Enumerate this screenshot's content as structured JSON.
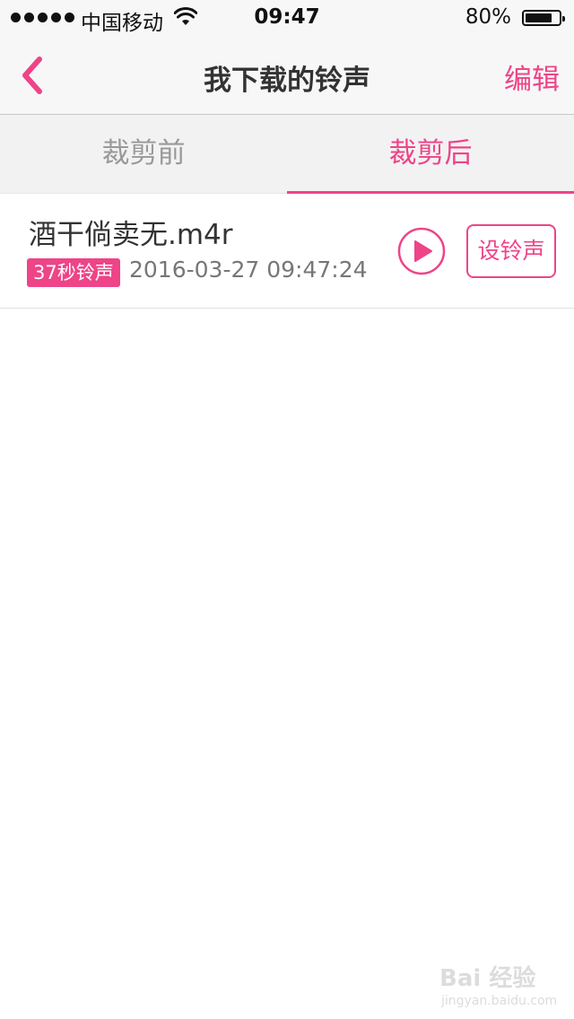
{
  "status_bar": {
    "carrier": "中国移动",
    "time": "09:47",
    "battery_percent": "80%",
    "battery_level": 0.8,
    "signal_bars": 5
  },
  "nav": {
    "title": "我下载的铃声",
    "edit_label": "编辑",
    "back_icon": "chevron-left-icon"
  },
  "tabs": [
    {
      "label": "裁剪前",
      "active": false
    },
    {
      "label": "裁剪后",
      "active": true
    }
  ],
  "ringtones": [
    {
      "name": "酒干倘卖无.m4r",
      "duration_badge": "37秒铃声",
      "date": "2016-03-27 09:47:24",
      "set_label": "设铃声"
    }
  ],
  "watermark": {
    "logo_text": "Bai 经验",
    "url": "jingyan.baidu.com"
  },
  "colors": {
    "accent": "#ee4488",
    "text": "#333333",
    "muted": "#999999",
    "bar_bg": "#f7f7f7"
  }
}
